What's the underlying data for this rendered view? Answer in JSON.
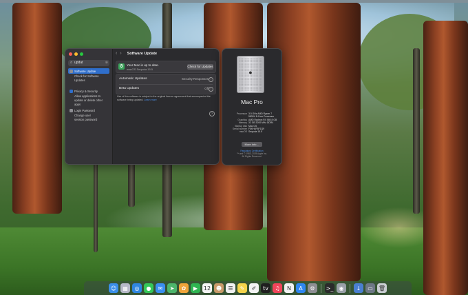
{
  "settings_window": {
    "search_query": "updat",
    "sidebar": [
      {
        "label": "Software Update",
        "selected": true,
        "color": "#8e8e93",
        "sub": [
          "Check for Software",
          "Updates"
        ]
      },
      {
        "label": "Privacy & Security",
        "selected": false,
        "color": "#2f6ecb",
        "sub": [
          "Allow applications to",
          "update or delete other",
          "apps"
        ]
      },
      {
        "label": "Login Password",
        "selected": false,
        "color": "#8e8e93",
        "sub": [
          "Change user",
          "session password"
        ]
      }
    ],
    "toolbar": {
      "back": "‹",
      "forward": "›",
      "title": "Software Update"
    },
    "status": {
      "line1": "Your Mac is up to date.",
      "line2": "macOS Sequoia 15.5",
      "check_button": "Check for Updates"
    },
    "options": [
      {
        "label": "Automatic Updates",
        "value": "Security Responses"
      },
      {
        "label": "Beta Updates",
        "value": "Off"
      }
    ],
    "note": {
      "text": "Use of this software is subject to the original licence agreement that accompanied the software being updated.",
      "link": "Learn more"
    },
    "help": "?"
  },
  "about_window": {
    "model": "Mac Pro",
    "specs": [
      {
        "key": "Processor",
        "value": "3.5 GHz AMD Ryzen 7 5800X 8-Core Processor"
      },
      {
        "key": "Graphics",
        "value": "AMD Radeon RX 580 8 GB"
      },
      {
        "key": "Memory",
        "value": "32 GB 3200 MHz DDR4"
      },
      {
        "key": "Startup disk",
        "value": "Mac OS"
      },
      {
        "key": "Serial number",
        "value": "F5KH4F8F1Q9"
      },
      {
        "key": "macOS",
        "value": "Sequoia 15.5"
      }
    ],
    "more_button": "More Info…",
    "regulatory_link": "Regulatory Certification",
    "copyright_lines": [
      "™ and © 1983–2025 Apple Inc.",
      "All Rights Reserved."
    ]
  },
  "dock": [
    {
      "name": "finder",
      "glyph": "☺",
      "color": "#3b8ee8"
    },
    {
      "name": "launchpad",
      "glyph": "▦",
      "color": "#b7b9c8"
    },
    {
      "name": "safari",
      "glyph": "◎",
      "color": "#2f86e0"
    },
    {
      "name": "messages",
      "glyph": "●",
      "color": "#35c759"
    },
    {
      "name": "mail",
      "glyph": "✉",
      "color": "#3a8ef0"
    },
    {
      "name": "maps",
      "glyph": "➤",
      "color": "#4cb56b"
    },
    {
      "name": "photos",
      "glyph": "✿",
      "color": "#f0a43a"
    },
    {
      "name": "facetime",
      "glyph": "▶",
      "color": "#2fb552"
    },
    {
      "name": "calendar",
      "glyph": "12",
      "color": "#f4f4f4"
    },
    {
      "name": "contacts",
      "glyph": "☻",
      "color": "#c89a6a"
    },
    {
      "name": "reminders",
      "glyph": "☰",
      "color": "#f1f1f1"
    },
    {
      "name": "notes",
      "glyph": "✎",
      "color": "#f5d44b"
    },
    {
      "name": "freeform",
      "glyph": "✐",
      "color": "#f4f4f4"
    },
    {
      "name": "tv",
      "glyph": "tv",
      "color": "#1f1f1f"
    },
    {
      "name": "music",
      "glyph": "♫",
      "color": "#f0455a"
    },
    {
      "name": "news",
      "glyph": "N",
      "color": "#f2f2f2"
    },
    {
      "name": "app-store",
      "glyph": "A",
      "color": "#2f86f0"
    },
    {
      "name": "system-settings",
      "glyph": "⚙",
      "color": "#8e8e93"
    },
    {
      "name": "sep",
      "glyph": "",
      "color": ""
    },
    {
      "name": "terminal",
      "glyph": ">_",
      "color": "#2a2a2a"
    },
    {
      "name": "disk-utility",
      "glyph": "◉",
      "color": "#9aa0a8"
    },
    {
      "name": "sep",
      "glyph": "",
      "color": ""
    },
    {
      "name": "downloads",
      "glyph": "↓",
      "color": "#4a7fd0"
    },
    {
      "name": "window",
      "glyph": "▭",
      "color": "#6d7785"
    },
    {
      "name": "trash",
      "glyph": "🗑",
      "color": "#c9cdd2"
    }
  ]
}
